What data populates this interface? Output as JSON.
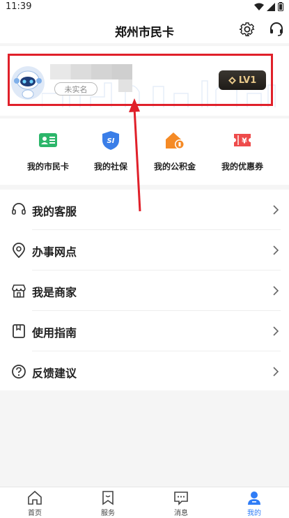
{
  "status_bar": {
    "time": "11:39"
  },
  "header": {
    "title": "郑州市民卡"
  },
  "profile": {
    "realname_status": "未实名",
    "level": "LV1"
  },
  "quick_actions": [
    {
      "label": "我的市民卡",
      "icon": "citizen-card-icon",
      "color": "#2cb66a"
    },
    {
      "label": "我的社保",
      "icon": "social-security-icon",
      "color": "#3a7ee8",
      "glyph": "SI"
    },
    {
      "label": "我的公积金",
      "icon": "housing-fund-icon",
      "color": "#f58a25"
    },
    {
      "label": "我的优惠券",
      "icon": "coupon-icon",
      "color": "#ee4b4b",
      "glyph": "¥"
    }
  ],
  "menu": [
    {
      "label": "我的客服",
      "icon": "headset-icon"
    },
    {
      "label": "办事网点",
      "icon": "location-pin-icon"
    },
    {
      "label": "我是商家",
      "icon": "store-icon"
    },
    {
      "label": "使用指南",
      "icon": "guide-book-icon"
    },
    {
      "label": "反馈建议",
      "icon": "question-circle-icon"
    }
  ],
  "tabs": [
    {
      "label": "首页",
      "icon": "home-icon",
      "active": false
    },
    {
      "label": "服务",
      "icon": "service-bookmark-icon",
      "active": false
    },
    {
      "label": "消息",
      "icon": "message-icon",
      "active": false
    },
    {
      "label": "我的",
      "icon": "profile-icon",
      "active": true
    }
  ],
  "colors": {
    "accent": "#2f7cf6",
    "annotation": "#e0202a",
    "badge_bg": "#2a2622",
    "badge_text": "#e8c98a"
  }
}
